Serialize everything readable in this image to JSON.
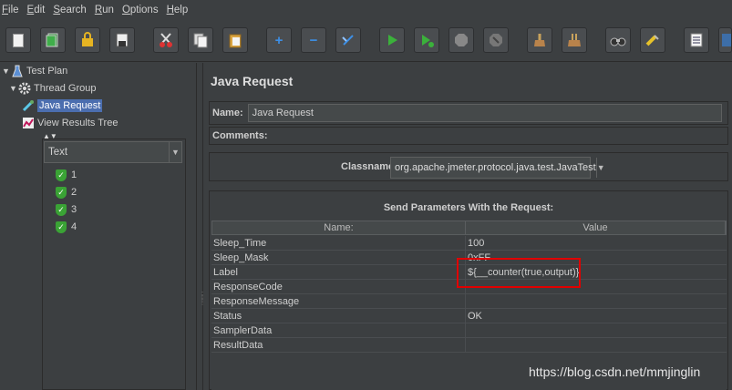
{
  "menu": [
    {
      "mnemonic": "F",
      "rest": "ile"
    },
    {
      "mnemonic": "E",
      "rest": "dit"
    },
    {
      "mnemonic": "S",
      "rest": "earch"
    },
    {
      "mnemonic": "R",
      "rest": "un"
    },
    {
      "mnemonic": "O",
      "rest": "ptions"
    },
    {
      "mnemonic": "H",
      "rest": "elp"
    }
  ],
  "toolbar": {
    "buttons": [
      "new-icon",
      "templates-icon",
      "open-icon",
      "save-icon",
      "cut-icon",
      "copy-icon",
      "paste-icon",
      "expand-icon",
      "collapse-icon",
      "toggle-icon",
      "start-icon",
      "start-no-pause-icon",
      "stop-icon",
      "shutdown-icon",
      "clear-icon",
      "clear-all-icon",
      "search-icon",
      "reset-search-icon",
      "function-helper-icon",
      "help-icon"
    ],
    "expand_glyph": "+",
    "collapse_glyph": "−"
  },
  "tree": {
    "test_plan": "Test Plan",
    "thread_group": "Thread Group",
    "java_request": "Java Request",
    "view_results_tree": "View Results Tree"
  },
  "overlay": {
    "select_value": "Text",
    "items": [
      "1",
      "2",
      "3",
      "4"
    ]
  },
  "panel": {
    "title": "Java Request",
    "name_label": "Name:",
    "name_value": "Java Request",
    "comments_label": "Comments:",
    "classname_label": "Classname:",
    "classname_value": "org.apache.jmeter.protocol.java.test.JavaTest",
    "params_title": "Send Parameters With the Request:",
    "col_name": "Name:",
    "col_value": "Value",
    "rows": [
      {
        "name": "Sleep_Time",
        "value": "100"
      },
      {
        "name": "Sleep_Mask",
        "value": "0xFF"
      },
      {
        "name": "Label",
        "value": "${__counter(true,output)}"
      },
      {
        "name": "ResponseCode",
        "value": ""
      },
      {
        "name": "ResponseMessage",
        "value": ""
      },
      {
        "name": "Status",
        "value": "OK"
      },
      {
        "name": "SamplerData",
        "value": ""
      },
      {
        "name": "ResultData",
        "value": ""
      }
    ]
  },
  "watermark": "https://blog.csdn.net/mmjinglin",
  "colors": {
    "selection": "#4b6eaf",
    "highlight_box": "#e00000",
    "background": "#3c3f41"
  }
}
